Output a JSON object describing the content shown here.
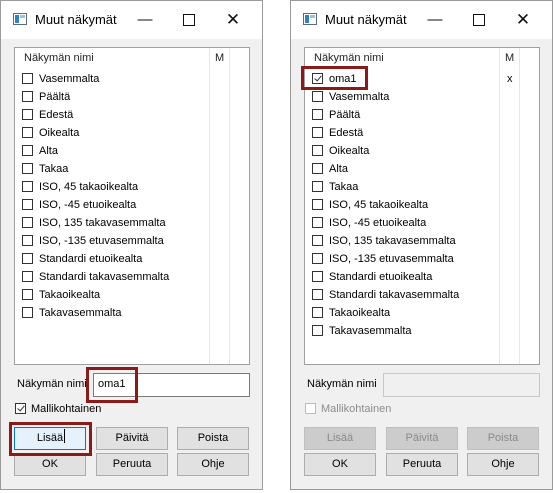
{
  "left_dialog": {
    "title": "Muut näkymät",
    "col_name": "Näkymän nimi",
    "col_m": "M",
    "items": [
      {
        "label": "Vasemmalta",
        "checked": false,
        "m": ""
      },
      {
        "label": "Päältä",
        "checked": false,
        "m": ""
      },
      {
        "label": "Edestä",
        "checked": false,
        "m": ""
      },
      {
        "label": "Oikealta",
        "checked": false,
        "m": ""
      },
      {
        "label": "Alta",
        "checked": false,
        "m": ""
      },
      {
        "label": "Takaa",
        "checked": false,
        "m": ""
      },
      {
        "label": "ISO, 45 takaoikealta",
        "checked": false,
        "m": ""
      },
      {
        "label": "ISO, -45 etuoikealta",
        "checked": false,
        "m": ""
      },
      {
        "label": "ISO, 135 takavasemmalta",
        "checked": false,
        "m": ""
      },
      {
        "label": "ISO, -135 etuvasemmalta",
        "checked": false,
        "m": ""
      },
      {
        "label": "Standardi etuoikealta",
        "checked": false,
        "m": ""
      },
      {
        "label": "Standardi takavasemmalta",
        "checked": false,
        "m": ""
      },
      {
        "label": "Takaoikealta",
        "checked": false,
        "m": ""
      },
      {
        "label": "Takavasemmalta",
        "checked": false,
        "m": ""
      }
    ],
    "name_label": "Näkymän nimi",
    "name_value": "oma1",
    "model_specific_label": "Mallikohtainen",
    "model_specific_checked": true,
    "buttons": {
      "add": "Lisää",
      "apply": "Päivitä",
      "delete": "Poista",
      "ok": "OK",
      "cancel": "Peruuta",
      "help": "Ohje"
    }
  },
  "right_dialog": {
    "title": "Muut näkymät",
    "col_name": "Näkymän nimi",
    "col_m": "M",
    "items": [
      {
        "label": "oma1",
        "checked": true,
        "m": "x"
      },
      {
        "label": "Vasemmalta",
        "checked": false,
        "m": ""
      },
      {
        "label": "Päältä",
        "checked": false,
        "m": ""
      },
      {
        "label": "Edestä",
        "checked": false,
        "m": ""
      },
      {
        "label": "Oikealta",
        "checked": false,
        "m": ""
      },
      {
        "label": "Alta",
        "checked": false,
        "m": ""
      },
      {
        "label": "Takaa",
        "checked": false,
        "m": ""
      },
      {
        "label": "ISO, 45 takaoikealta",
        "checked": false,
        "m": ""
      },
      {
        "label": "ISO, -45 etuoikealta",
        "checked": false,
        "m": ""
      },
      {
        "label": "ISO, 135 takavasemmalta",
        "checked": false,
        "m": ""
      },
      {
        "label": "ISO, -135 etuvasemmalta",
        "checked": false,
        "m": ""
      },
      {
        "label": "Standardi etuoikealta",
        "checked": false,
        "m": ""
      },
      {
        "label": "Standardi takavasemmalta",
        "checked": false,
        "m": ""
      },
      {
        "label": "Takaoikealta",
        "checked": false,
        "m": ""
      },
      {
        "label": "Takavasemmalta",
        "checked": false,
        "m": ""
      }
    ],
    "name_label": "Näkymän nimi",
    "name_value": "",
    "model_specific_label": "Mallikohtainen",
    "model_specific_checked": false,
    "buttons": {
      "add": "Lisää",
      "apply": "Päivitä",
      "delete": "Poista",
      "ok": "OK",
      "cancel": "Peruuta",
      "help": "Ohje"
    }
  },
  "window_controls": {
    "minimize": "—",
    "close": "✕"
  },
  "colors": {
    "highlight": "#8b1a1a",
    "focus_border": "#0078d7",
    "focus_fill": "#e5f1fb"
  }
}
